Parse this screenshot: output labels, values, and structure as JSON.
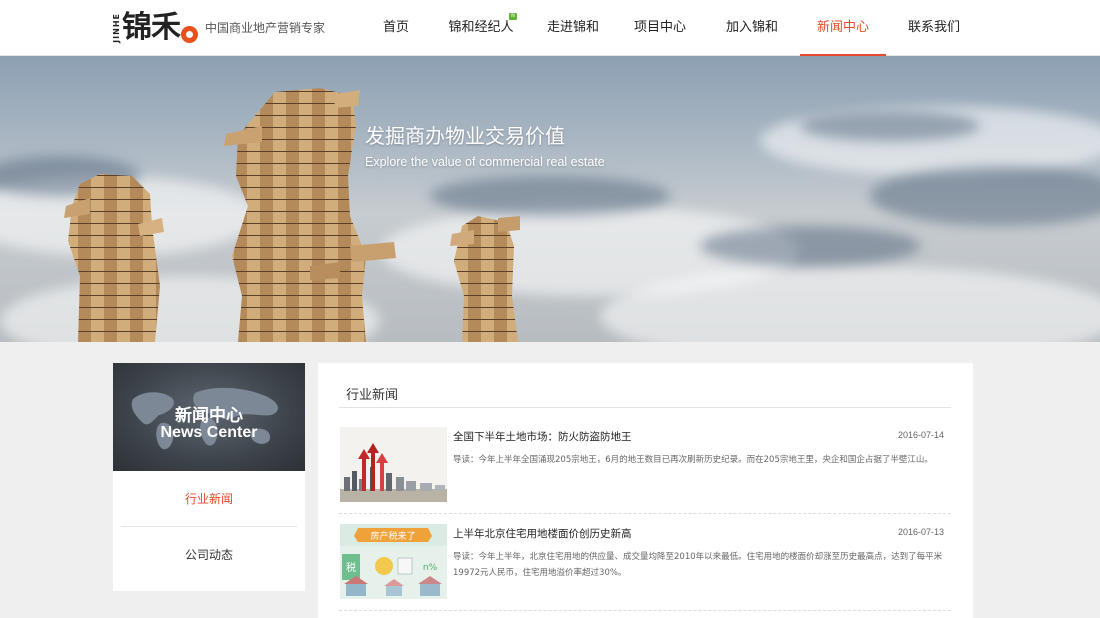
{
  "header": {
    "logo_pinyin": "JINHE",
    "logo_text": "锦禾",
    "slogan": "中国商业地产营销专家",
    "nav": [
      {
        "label": "首页",
        "active": false
      },
      {
        "label": "锦和经纪人",
        "active": false,
        "badge": "N"
      },
      {
        "label": "走进锦和",
        "active": false
      },
      {
        "label": "项目中心",
        "active": false
      },
      {
        "label": "加入锦和",
        "active": false
      },
      {
        "label": "新闻中心",
        "active": true
      },
      {
        "label": "联系我们",
        "active": false
      }
    ]
  },
  "banner": {
    "title": "发掘商办物业交易价值",
    "subtitle": "Explore the value of commercial real estate"
  },
  "sidebar": {
    "heading_cn": "新闻中心",
    "heading_en": "News Center",
    "items": [
      {
        "label": "行业新闻",
        "active": true
      },
      {
        "label": "公司动态",
        "active": false
      }
    ]
  },
  "main": {
    "section_title": "行业新闻",
    "news": [
      {
        "title": "全国下半年土地市场：防火防盗防地王",
        "date": "2016-07-14",
        "summary": "导读：今年上半年全国涌现205宗地王，6月的地王数目已再次刷新历史纪录。而在205宗地王里，央企和国企占据了半壁江山。"
      },
      {
        "title": "上半年北京住宅用地楼面价创历史新高",
        "date": "2016-07-13",
        "summary": "导读：今年上半年，北京住宅用地的供应量、成交量均降至2010年以来最低。住宅用地的楼面价却涨至历史最高点，达到了每平米19972元人民币，住宅用地溢价率超过30%。",
        "thumb_banner": "房产税来了",
        "thumb_tax": "税",
        "thumb_percent": "n%"
      }
    ]
  },
  "colors": {
    "accent": "#e54b2d",
    "logo_orange": "#e8501e"
  }
}
